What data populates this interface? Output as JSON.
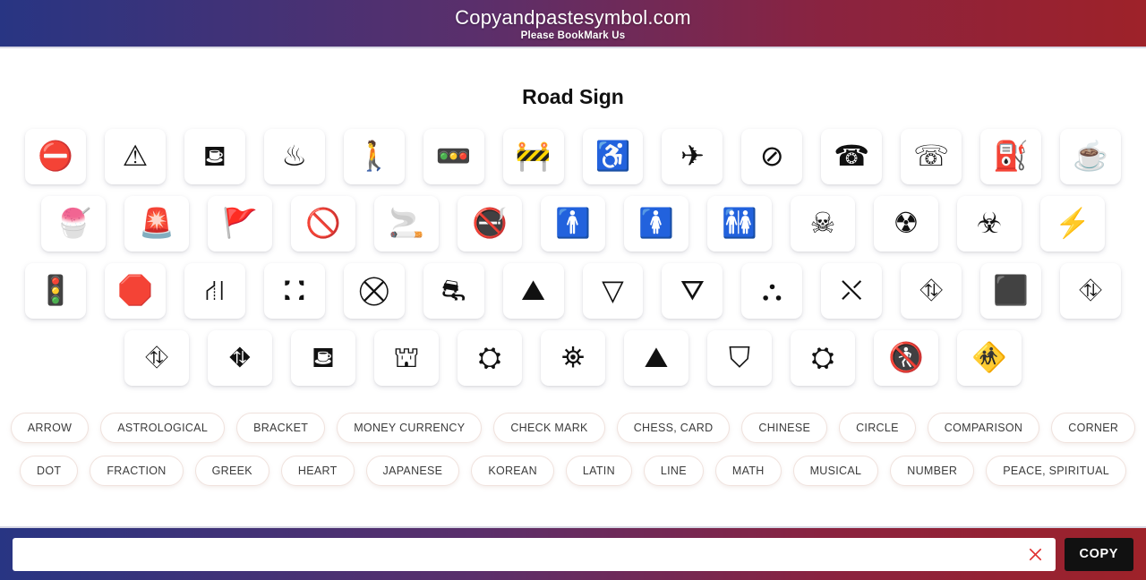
{
  "header": {
    "title": "Copyandpastesymbol.com",
    "subtitle": "Please BookMark Us",
    "gradient_start": "#283583",
    "gradient_end": "#9e2229"
  },
  "main": {
    "page_title": "Road Sign",
    "symbol_rows": [
      [
        "⛔",
        "⚠",
        "⛾",
        "♨",
        "🚶",
        "🚥",
        "🚧",
        "♿",
        "✈",
        "⊘",
        "☎",
        "☏",
        "⛽",
        "☕"
      ],
      [
        "🍧",
        "🚨",
        "🚩",
        "🚫",
        "🚬",
        "🚭",
        "🚹",
        "🚺",
        "🚻",
        "☠",
        "☢",
        "☣",
        "⚡"
      ],
      [
        "🚦",
        "🛑",
        "⛙",
        "⛚",
        "⛒",
        "⛐",
        "⛰",
        "▽",
        "⛛",
        "⛬",
        "⛌",
        "⛗",
        "⬛",
        "⛗"
      ],
      [
        "⛗",
        "⛖",
        "⛾",
        "⛫",
        "⛭",
        "⛯",
        "⛰",
        "⛉",
        "⛭",
        "🚷",
        "🚸"
      ]
    ]
  },
  "categories": {
    "row1": [
      "ARROW",
      "ASTROLOGICAL",
      "BRACKET",
      "MONEY CURRENCY",
      "CHECK MARK",
      "CHESS, CARD",
      "CHINESE",
      "CIRCLE",
      "COMPARISON",
      "CORNER"
    ],
    "row2": [
      "DOT",
      "FRACTION",
      "GREEK",
      "HEART",
      "JAPANESE",
      "KOREAN",
      "LATIN",
      "LINE",
      "MATH",
      "MUSICAL",
      "NUMBER",
      "PEACE, SPIRITUAL"
    ]
  },
  "bottom_bar": {
    "input_value": "",
    "input_placeholder": "",
    "clear_icon": "close-icon",
    "copy_label": "COPY",
    "copy_bg": "#111111"
  }
}
